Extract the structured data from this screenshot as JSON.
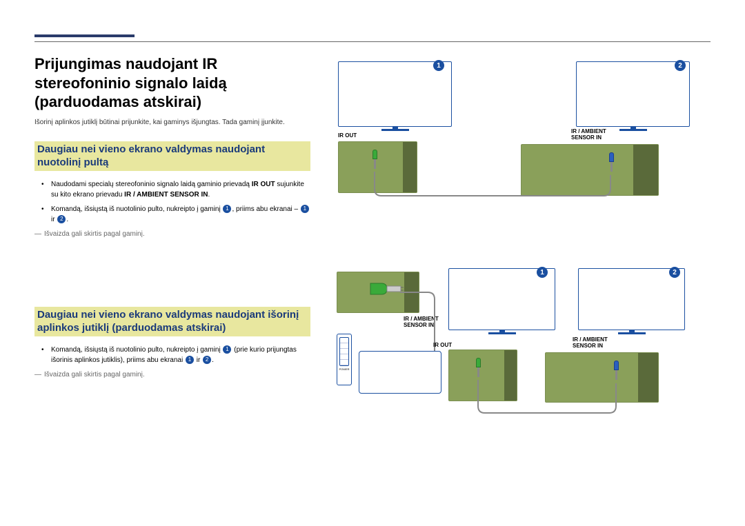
{
  "title": "Prijungimas naudojant IR stereofoninio signalo laidą\n(parduodamas atskirai)",
  "intro": "Išorinį aplinkos jutiklį būtinai prijunkite, kai gaminys išjungtas. Tada gaminį įjunkite.",
  "section1": {
    "heading": "Daugiau nei vieno ekrano valdymas naudojant nuotolinį pultą",
    "bullet1_pre": "Naudodami specialų stereofoninio signalo laidą gaminio prievadą ",
    "bullet1_bold1": "IR OUT",
    "bullet1_mid": " sujunkite su kito ekrano prievadu ",
    "bullet1_bold2": "IR / AMBIENT SENSOR IN",
    "bullet1_end": ".",
    "bullet2_pre": "Komandą, išsiųstą iš nuotolinio pulto, nukreipto į gaminį ",
    "bullet2_mid": ", priims abu ekranai – ",
    "bullet2_and": " ir ",
    "bullet2_end": ".",
    "note": "Išvaizda gali skirtis pagal gaminį."
  },
  "section2": {
    "heading": "Daugiau nei vieno ekrano valdymas naudojant išorinį aplinkos jutiklį (parduodamas atskirai)",
    "bullet1_pre": "Komandą, išsiųstą iš nuotolinio pulto, nukreipto į gaminį ",
    "bullet1_mid": " (prie kurio prijungtas išorinis aplinkos jutiklis), priims abu ekranai ",
    "bullet1_and": " ir ",
    "bullet1_end": ".",
    "note": "Išvaizda gali skirtis pagal gaminį."
  },
  "labels": {
    "ir_out": "IR OUT",
    "ir_ambient": "IR / AMBIENT\nSENSOR IN",
    "power": "POWER"
  },
  "nums": {
    "one": "1",
    "two": "2"
  }
}
